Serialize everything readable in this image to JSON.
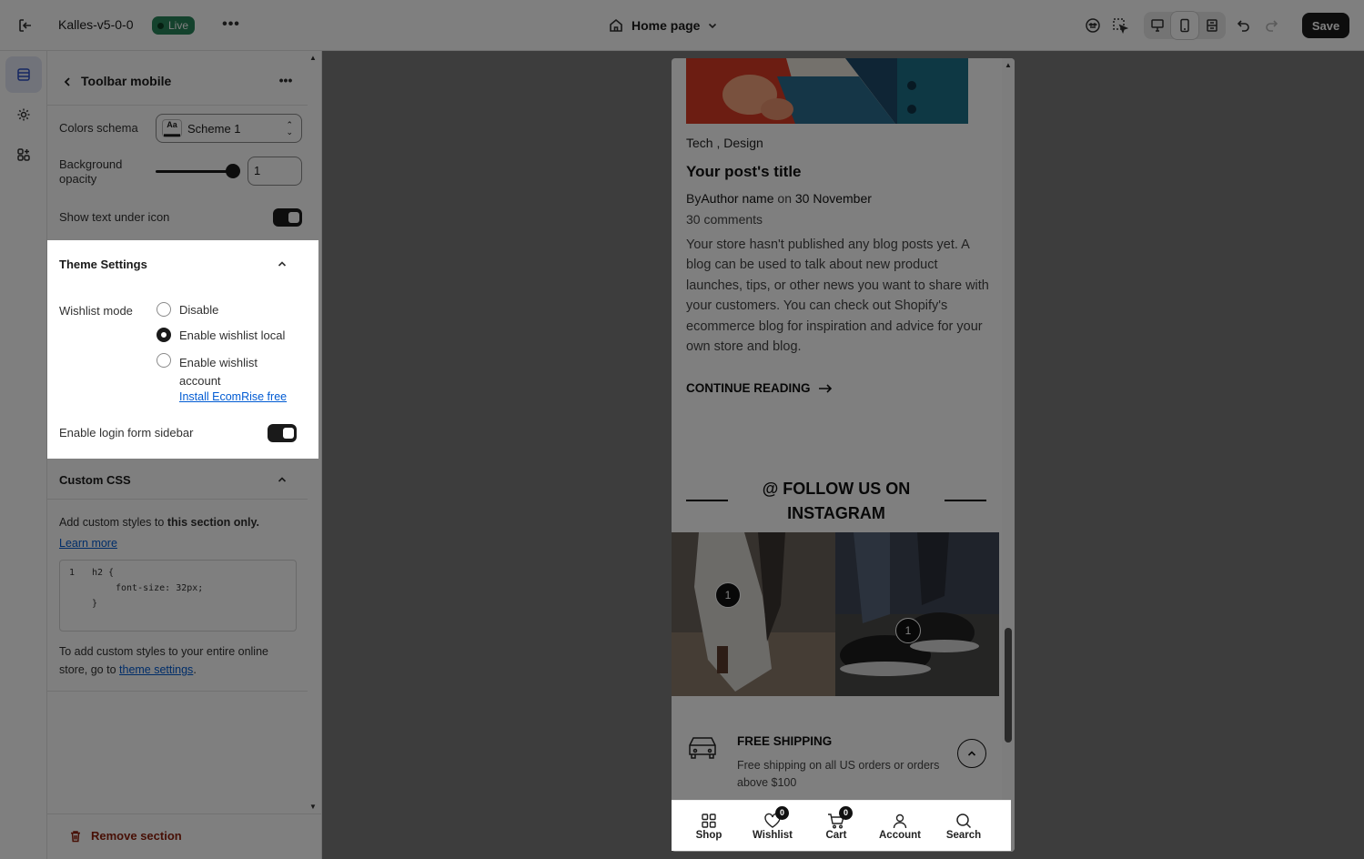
{
  "topbar": {
    "store_name": "Kalles-v5-0-0",
    "live_label": "Live",
    "more_label": "•••",
    "page_picker_label": "Home page",
    "save_label": "Save"
  },
  "panel": {
    "title": "Toolbar mobile",
    "more_label": "•••",
    "colors_schema_label": "Colors schema",
    "colors_schema_value": "Scheme 1",
    "bg_opacity_label": "Background opacity",
    "bg_opacity_value": "1",
    "bg_opacity_fraction": 1.0,
    "show_text_label": "Show text under icon",
    "show_text_enabled": true
  },
  "theme_settings": {
    "title": "Theme Settings",
    "wishlist_mode_label": "Wishlist mode",
    "options": [
      "Disable",
      "Enable wishlist local",
      "Enable wishlist account"
    ],
    "selected_option": "Enable wishlist local",
    "install_link": "Install EcomRise free",
    "login_sidebar_label": "Enable login form sidebar",
    "login_sidebar_enabled": true
  },
  "custom_css": {
    "title": "Custom CSS",
    "intro_prefix": "Add custom styles to ",
    "intro_bold": "this section only.",
    "learn_more": "Learn more",
    "code_line_number": "1",
    "code_line1": "h2 {",
    "code_line2": "font-size: 32px;",
    "code_line3": "}",
    "footer_prefix": "To add custom styles to your entire online store, go to ",
    "footer_link": "theme settings",
    "footer_suffix": "."
  },
  "remove_section_label": "Remove section",
  "preview": {
    "categories": "Tech , Design",
    "post_title": "Your post's title",
    "byline_prefix": "By",
    "byline_author": "Author name",
    "byline_on": " on ",
    "byline_date": "30 November",
    "comments": "30 comments",
    "excerpt": "Your store hasn't published any blog posts yet. A blog can be used to talk about new product launches, tips, or other news you want to share with your customers. You can check out Shopify's ecommerce blog for inspiration and advice for your own store and blog.",
    "continue_reading": "CONTINUE READING",
    "follow_heading": "@ FOLLOW US ON INSTAGRAM",
    "insta_badges": [
      "1",
      "1"
    ],
    "shipping_title": "FREE SHIPPING",
    "shipping_desc": "Free shipping on all US orders or orders above $100"
  },
  "toolbar": {
    "items": [
      {
        "label": "Shop",
        "icon": "grid-icon"
      },
      {
        "label": "Wishlist",
        "icon": "heart-icon",
        "count": "0"
      },
      {
        "label": "Cart",
        "icon": "cart-icon",
        "count": "0"
      },
      {
        "label": "Account",
        "icon": "user-icon"
      },
      {
        "label": "Search",
        "icon": "search-icon"
      }
    ]
  },
  "colors": {
    "live_badge": "#29845a",
    "save_button": "#1a1a1a",
    "link": "#005bd3",
    "remove": "#8e1f0b"
  }
}
